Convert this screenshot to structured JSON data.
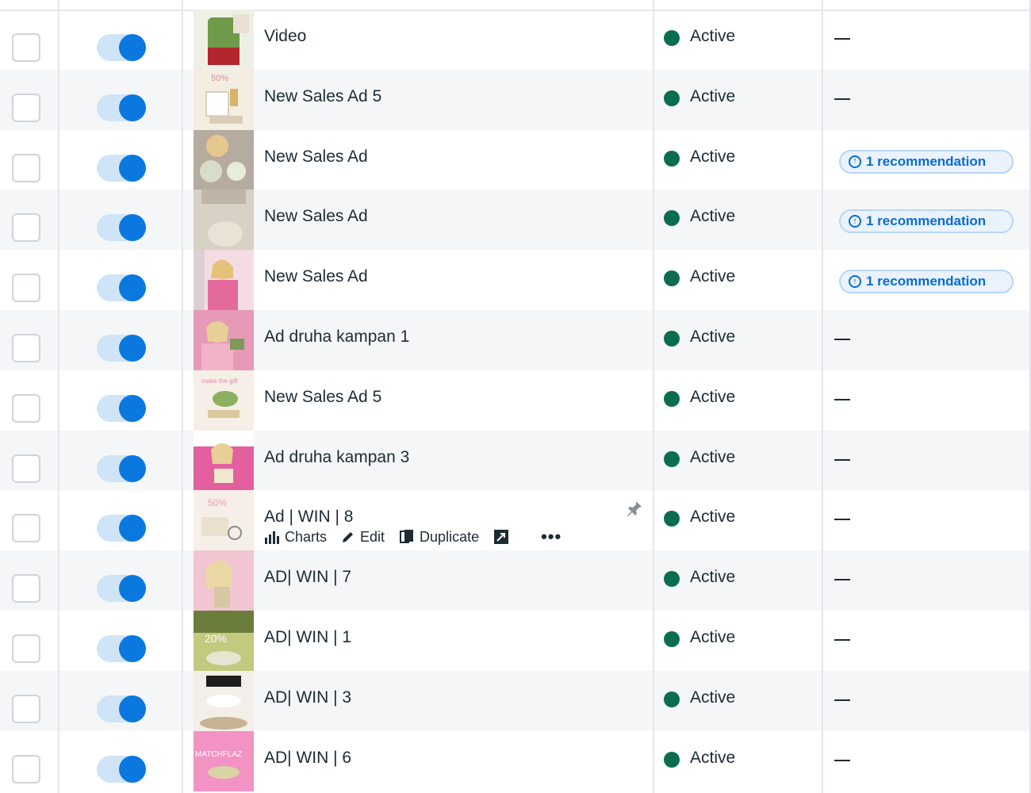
{
  "rows": [
    {
      "name": "Video",
      "status": "Active",
      "delivery": "—",
      "thumb": "green-jar"
    },
    {
      "name": "New Sales Ad 5",
      "status": "Active",
      "delivery": "—",
      "thumb": "cream-kit"
    },
    {
      "name": "New Sales Ad",
      "status": "Active",
      "delivery": "1 recommendation",
      "thumb": "cream-jars"
    },
    {
      "name": "New Sales Ad",
      "status": "Active",
      "delivery": "1 recommendation",
      "thumb": "cream-jar-open"
    },
    {
      "name": "New Sales Ad",
      "status": "Active",
      "delivery": "1 recommendation",
      "thumb": "woman-pink"
    },
    {
      "name": "Ad druha kampan 1",
      "status": "Active",
      "delivery": "—",
      "thumb": "woman-pink-2"
    },
    {
      "name": "New Sales Ad 5",
      "status": "Active",
      "delivery": "—",
      "thumb": "green-jar-pastel"
    },
    {
      "name": "Ad druha kampan 3",
      "status": "Active",
      "delivery": "—",
      "thumb": "woman-pink-3"
    },
    {
      "name": "Ad | WIN | 8",
      "status": "Active",
      "delivery": "—",
      "thumb": "sale-kit",
      "hover": true
    },
    {
      "name": "AD| WIN | 7",
      "status": "Active",
      "delivery": "—",
      "thumb": "woman-blonde"
    },
    {
      "name": "AD| WIN | 1",
      "status": "Active",
      "delivery": "—",
      "thumb": "green-sale"
    },
    {
      "name": "AD| WIN | 3",
      "status": "Active",
      "delivery": "—",
      "thumb": "jar-table"
    },
    {
      "name": "AD| WIN | 6",
      "status": "Active",
      "delivery": "—",
      "thumb": "pink-banner"
    }
  ],
  "row_actions": {
    "charts_label": "Charts",
    "edit_label": "Edit",
    "duplicate_label": "Duplicate",
    "more_label": "•••"
  },
  "icons": {
    "status": "status-dot-icon",
    "recommendation": "arrow-up-circle-icon",
    "pin": "pin-icon",
    "charts": "bar-chart-icon",
    "edit": "pencil-icon",
    "duplicate": "copy-icon",
    "share": "external-link-icon"
  },
  "colors": {
    "status_active": "#0b6d4f",
    "toggle_on": "#0a78de",
    "toggle_track": "#d0e4f8",
    "recommendation_text": "#0a6bd1",
    "row_alt": "#f5f6f7"
  }
}
